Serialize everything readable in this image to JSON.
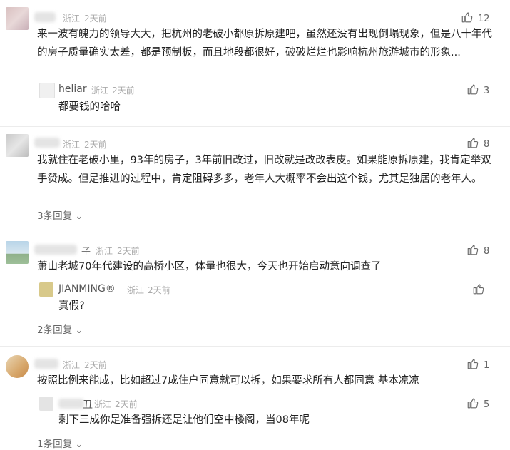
{
  "comments": [
    {
      "user": "",
      "location": "浙江",
      "time": "2天前",
      "likes": "12",
      "text": "来一波有魄力的领导大大，把杭州的老破小都原拆原建吧，虽然还没有出现倒塌现象，但是八十年代的房子质量确实太差，都是预制板，而且地段都很好，破破烂烂也影响杭州旅游城市的形象...",
      "replies": [
        {
          "user": "heliar",
          "location": "浙江",
          "time": "2天前",
          "likes": "3",
          "text": "都要钱的哈哈"
        }
      ]
    },
    {
      "user": "",
      "location": "浙江",
      "time": "2天前",
      "likes": "8",
      "text": "我就住在老破小里，93年的房子，3年前旧改过，旧改就是改改表皮。如果能原拆原建，我肯定举双手赞成。但是推进的过程中，肯定阻碍多多，老年人大概率不会出这个钱，尤其是独居的老年人。",
      "more": "3条回复"
    },
    {
      "user": "子",
      "location": "浙江",
      "time": "2天前",
      "likes": "8",
      "text": "萧山老城70年代建设的高桥小区，体量也很大，今天也开始启动意向调查了",
      "replies": [
        {
          "user": "JIANMING®",
          "location": "浙江",
          "time": "2天前",
          "likes": "",
          "text": "真假?"
        }
      ],
      "more": "2条回复"
    },
    {
      "user": "",
      "location": "浙江",
      "time": "2天前",
      "likes": "1",
      "text": "按照比例来能成，比如超过7成住户同意就可以拆，如果要求所有人都同意 基本凉凉",
      "replies": [
        {
          "user": "丑",
          "location": "浙江",
          "time": "2天前",
          "likes": "5",
          "text": "剩下三成你是准备强拆还是让他们空中楼阁，当08年呢"
        }
      ],
      "more": "1条回复"
    }
  ],
  "icons": {
    "like": "thumbs-up-icon",
    "chevron": "chevron-down-icon"
  },
  "colors": {
    "text": "#222222",
    "meta": "#aaaaaa",
    "link": "#666666"
  }
}
